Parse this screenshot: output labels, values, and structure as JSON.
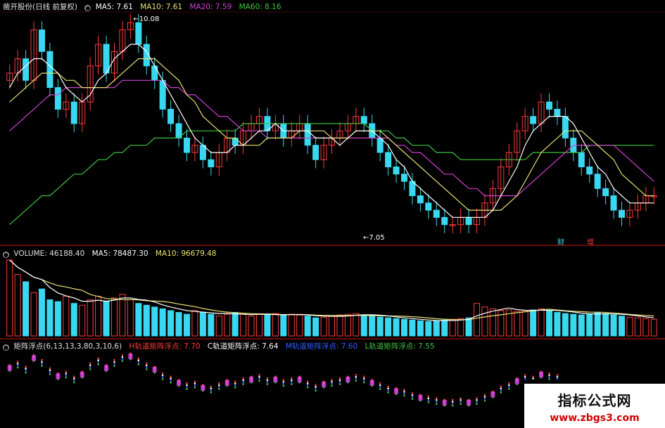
{
  "chart_data": [
    {
      "type": "line",
      "panel": "price",
      "header": {
        "title": "凿开股份(日线 前复权)",
        "ma5": "MA5: 7.61",
        "ma10": "MA10: 7.61",
        "ma20": "MA20: 7.59",
        "ma60": "MA60: 8.16"
      },
      "annotations": {
        "high": "10.08",
        "low": "7.05",
        "markers": [
          "财",
          "增"
        ]
      },
      "ylim": [
        7.05,
        10.08
      ],
      "colors": {
        "up": "#ff3a3a",
        "down": "#39d8f0",
        "ma5": "#ffffff",
        "ma10": "#e8e070",
        "ma20": "#d040d0",
        "ma60": "#3fc43f"
      },
      "close": [
        9.3,
        9.5,
        9.2,
        9.9,
        9.6,
        9.1,
        8.8,
        8.9,
        8.6,
        8.9,
        9.4,
        9.7,
        9.3,
        9.6,
        9.9,
        10.0,
        9.7,
        9.4,
        9.2,
        8.8,
        8.6,
        8.4,
        8.2,
        8.3,
        8.1,
        8.0,
        8.2,
        8.4,
        8.3,
        8.5,
        8.6,
        8.7,
        8.5,
        8.6,
        8.4,
        8.5,
        8.6,
        8.3,
        8.1,
        8.3,
        8.4,
        8.5,
        8.6,
        8.7,
        8.6,
        8.4,
        8.2,
        8.0,
        7.9,
        7.8,
        7.6,
        7.5,
        7.4,
        7.3,
        7.2,
        7.2,
        7.3,
        7.2,
        7.3,
        7.5,
        7.7,
        8.0,
        8.2,
        8.5,
        8.7,
        8.6,
        8.9,
        8.8,
        8.7,
        8.4,
        8.2,
        8.0,
        7.9,
        7.7,
        7.6,
        7.4,
        7.3,
        7.4,
        7.5,
        7.6,
        7.6
      ],
      "ma5_line": [
        9.1,
        9.3,
        9.4,
        9.5,
        9.5,
        9.4,
        9.3,
        9.1,
        9.0,
        8.9,
        9.0,
        9.2,
        9.3,
        9.5,
        9.6,
        9.7,
        9.7,
        9.6,
        9.4,
        9.2,
        9.0,
        8.8,
        8.6,
        8.4,
        8.3,
        8.2,
        8.2,
        8.2,
        8.3,
        8.3,
        8.4,
        8.5,
        8.5,
        8.6,
        8.5,
        8.5,
        8.5,
        8.5,
        8.4,
        8.4,
        8.4,
        8.3,
        8.4,
        8.5,
        8.5,
        8.5,
        8.4,
        8.3,
        8.1,
        8.0,
        7.8,
        7.7,
        7.6,
        7.5,
        7.4,
        7.3,
        7.3,
        7.3,
        7.3,
        7.3,
        7.4,
        7.6,
        7.8,
        8.0,
        8.3,
        8.5,
        8.6,
        8.7,
        8.7,
        8.7,
        8.6,
        8.4,
        8.2,
        8.0,
        7.9,
        7.7,
        7.6,
        7.5,
        7.5,
        7.5,
        7.5
      ],
      "ma10_line": [
        8.9,
        9.0,
        9.1,
        9.2,
        9.3,
        9.3,
        9.3,
        9.2,
        9.2,
        9.1,
        9.1,
        9.1,
        9.1,
        9.2,
        9.3,
        9.4,
        9.5,
        9.5,
        9.5,
        9.4,
        9.3,
        9.2,
        9.0,
        8.9,
        8.7,
        8.6,
        8.5,
        8.4,
        8.4,
        8.3,
        8.3,
        8.3,
        8.4,
        8.4,
        8.4,
        8.4,
        8.5,
        8.5,
        8.5,
        8.5,
        8.4,
        8.4,
        8.4,
        8.5,
        8.5,
        8.5,
        8.5,
        8.4,
        8.3,
        8.2,
        8.1,
        8.0,
        7.9,
        7.8,
        7.7,
        7.6,
        7.5,
        7.4,
        7.4,
        7.4,
        7.4,
        7.4,
        7.5,
        7.6,
        7.8,
        8.0,
        8.2,
        8.3,
        8.4,
        8.5,
        8.5,
        8.5,
        8.4,
        8.3,
        8.2,
        8.1,
        7.9,
        7.8,
        7.7,
        7.6,
        7.6
      ],
      "ma20_line": [
        8.5,
        8.6,
        8.7,
        8.8,
        8.9,
        9.0,
        9.0,
        9.1,
        9.1,
        9.1,
        9.1,
        9.1,
        9.1,
        9.1,
        9.2,
        9.2,
        9.2,
        9.2,
        9.2,
        9.2,
        9.1,
        9.1,
        9.0,
        9.0,
        8.9,
        8.8,
        8.7,
        8.7,
        8.6,
        8.5,
        8.5,
        8.5,
        8.4,
        8.4,
        8.4,
        8.4,
        8.4,
        8.4,
        8.4,
        8.4,
        8.4,
        8.4,
        8.4,
        8.4,
        8.4,
        8.4,
        8.4,
        8.4,
        8.3,
        8.3,
        8.2,
        8.2,
        8.1,
        8.0,
        7.9,
        7.9,
        7.8,
        7.7,
        7.7,
        7.6,
        7.6,
        7.6,
        7.6,
        7.6,
        7.7,
        7.8,
        7.9,
        8.0,
        8.1,
        8.2,
        8.3,
        8.3,
        8.3,
        8.3,
        8.3,
        8.3,
        8.2,
        8.1,
        8.0,
        7.9,
        7.8
      ],
      "ma60_line": [
        7.2,
        7.3,
        7.4,
        7.5,
        7.6,
        7.6,
        7.7,
        7.8,
        7.9,
        7.9,
        8.0,
        8.1,
        8.1,
        8.2,
        8.2,
        8.3,
        8.3,
        8.3,
        8.4,
        8.4,
        8.4,
        8.4,
        8.5,
        8.5,
        8.5,
        8.5,
        8.5,
        8.5,
        8.5,
        8.6,
        8.6,
        8.6,
        8.6,
        8.6,
        8.6,
        8.6,
        8.6,
        8.6,
        8.6,
        8.6,
        8.6,
        8.6,
        8.6,
        8.6,
        8.6,
        8.5,
        8.5,
        8.5,
        8.4,
        8.4,
        8.3,
        8.3,
        8.3,
        8.2,
        8.2,
        8.2,
        8.1,
        8.1,
        8.1,
        8.1,
        8.1,
        8.1,
        8.1,
        8.1,
        8.1,
        8.2,
        8.2,
        8.2,
        8.2,
        8.2,
        8.2,
        8.2,
        8.3,
        8.3,
        8.3,
        8.3,
        8.3,
        8.3,
        8.3,
        8.3,
        8.3
      ]
    },
    {
      "type": "bar",
      "panel": "volume",
      "header": {
        "title": "VOLUME: 46188.40",
        "ma5": "MA5: 78487.30",
        "ma10": "MA10: 96679.48"
      },
      "colors": {
        "up": "#ff3a3a",
        "down": "#39d8f0",
        "ma5": "#ffffff",
        "ma10": "#e8e070"
      },
      "values": [
        210,
        170,
        150,
        120,
        130,
        100,
        95,
        110,
        90,
        85,
        100,
        110,
        95,
        105,
        115,
        100,
        90,
        85,
        80,
        75,
        70,
        65,
        60,
        70,
        65,
        60,
        55,
        60,
        65,
        60,
        55,
        60,
        58,
        62,
        57,
        60,
        58,
        55,
        50,
        52,
        55,
        58,
        60,
        62,
        58,
        55,
        52,
        50,
        48,
        46,
        44,
        42,
        40,
        42,
        44,
        46,
        48,
        50,
        90,
        80,
        75,
        70,
        72,
        68,
        70,
        72,
        75,
        70,
        65,
        62,
        60,
        58,
        60,
        65,
        62,
        58,
        55,
        52,
        50,
        48,
        46
      ]
    },
    {
      "type": "line",
      "panel": "indicator",
      "header": {
        "title": "矩阵浮点(6,13,13,3,80,3,10,6)",
        "h": "H轨道矩阵浮点: 7.70",
        "c": "C轨道矩阵浮点: 7.64",
        "m": "M轨道矩阵浮点: 7.60",
        "l": "L轨道矩阵浮点: 7.55"
      },
      "colors": {
        "h": "#ff3a3a",
        "c": "#ffffff",
        "m": "#3060ff",
        "l": "#3fc43f",
        "dot": "#e040e0"
      }
    }
  ],
  "logo": {
    "line1": "指标公式网",
    "line2": "www.zbgs3.com"
  }
}
